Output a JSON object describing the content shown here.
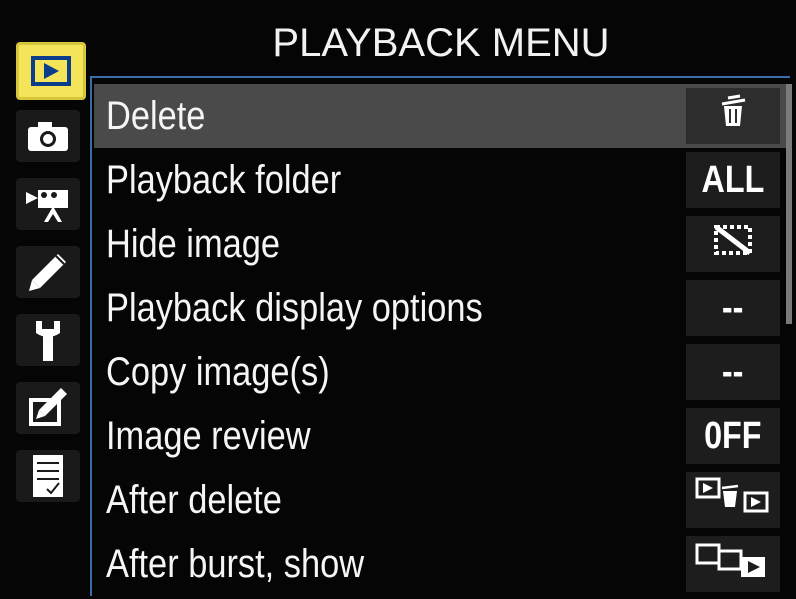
{
  "menu_title": "PLAYBACK MENU",
  "tabs": [
    {
      "name": "playback-tab-icon",
      "active": true
    },
    {
      "name": "camera-tab-icon",
      "active": false
    },
    {
      "name": "movie-tab-icon",
      "active": false
    },
    {
      "name": "pencil-tab-icon",
      "active": false
    },
    {
      "name": "wrench-tab-icon",
      "active": false
    },
    {
      "name": "retouch-tab-icon",
      "active": false
    },
    {
      "name": "my-menu-tab-icon",
      "active": false
    }
  ],
  "items": [
    {
      "label": "Delete",
      "value": "",
      "icon": "trash-icon",
      "selected": true
    },
    {
      "label": "Playback folder",
      "value": "ALL"
    },
    {
      "label": "Hide image",
      "value": "",
      "icon": "hide-image-icon"
    },
    {
      "label": "Playback display options",
      "value": "--"
    },
    {
      "label": "Copy image(s)",
      "value": "--"
    },
    {
      "label": "Image review",
      "value": "0FF"
    },
    {
      "label": "After delete",
      "value": "",
      "icon": "after-delete-icon"
    },
    {
      "label": "After burst, show",
      "value": "",
      "icon": "after-burst-icon"
    }
  ],
  "colors": {
    "active_tab": "#f4e45a",
    "selected_row": "#4a4a4a",
    "frame": "#3a6da8"
  }
}
